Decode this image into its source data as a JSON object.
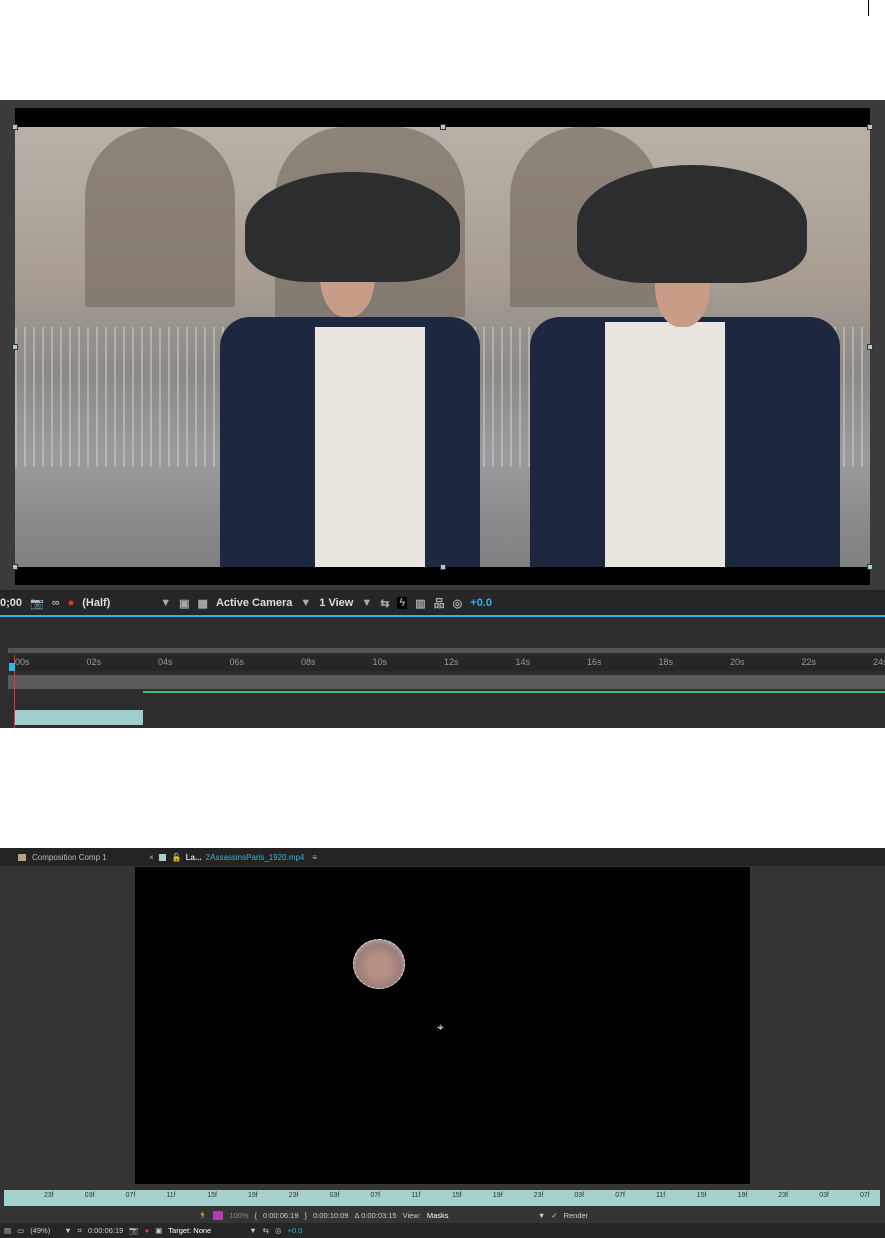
{
  "viewer1": {
    "toolbar": {
      "time": "0;00",
      "resolution": "(Half)",
      "camera": "Active Camera",
      "views": "1 View",
      "exposure": "+0.0"
    },
    "timeline": {
      "ticks": [
        "00s",
        "02s",
        "04s",
        "06s",
        "08s",
        "10s",
        "12s",
        "14s",
        "16s",
        "18s",
        "20s",
        "22s",
        "24s"
      ]
    }
  },
  "viewer2": {
    "tabs": [
      {
        "label": "Composition Comp 1"
      },
      {
        "prefix": "La...",
        "label": "2AssassinsParis_1920.mp4"
      }
    ],
    "ruler": [
      "23f",
      "03f",
      "07f",
      "11f",
      "15f",
      "19f",
      "23f",
      "03f",
      "07f",
      "11f",
      "15f",
      "19f",
      "23f",
      "03f",
      "07f",
      "11f",
      "15f",
      "19f",
      "23f",
      "03f",
      "07f"
    ],
    "controls": {
      "opacity": "100%",
      "in_time": "0:00:06:19",
      "out_time": "0:00:10:09",
      "duration": "Δ 0:00:03:15",
      "view_label": "View:",
      "view_value": "Masks",
      "render_label": "Render"
    },
    "bottom": {
      "zoom": "(49%)",
      "time": "0:00:06:19",
      "target": "Target: None",
      "exposure": "+0.0"
    }
  }
}
